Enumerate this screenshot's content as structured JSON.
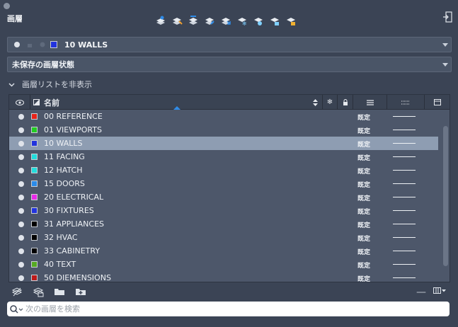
{
  "panel": {
    "title": "画層"
  },
  "current_layer": {
    "name": "10 WALLS",
    "color": "#2233dd"
  },
  "layer_state": {
    "value": "未保存の画層状態"
  },
  "hide_list": {
    "label": "画層リストを非表示"
  },
  "table": {
    "headers": {
      "name": "名前"
    },
    "rows": [
      {
        "name": "00 REFERENCE",
        "color": "#e8231a",
        "linetype": "既定",
        "selected": false
      },
      {
        "name": "01 VIEWPORTS",
        "color": "#22cc22",
        "linetype": "既定",
        "selected": false
      },
      {
        "name": "10 WALLS",
        "color": "#2233dd",
        "linetype": "既定",
        "selected": true
      },
      {
        "name": "11 FACING",
        "color": "#22dddd",
        "linetype": "既定",
        "selected": false
      },
      {
        "name": "12 HATCH",
        "color": "#22dddd",
        "linetype": "既定",
        "selected": false
      },
      {
        "name": "15 DOORS",
        "color": "#2a8ae8",
        "linetype": "既定",
        "selected": false
      },
      {
        "name": "20 ELECTRICAL",
        "color": "#e82ae8",
        "linetype": "既定",
        "selected": false
      },
      {
        "name": "30 FIXTURES",
        "color": "#2233dd",
        "linetype": "既定",
        "selected": false
      },
      {
        "name": "31 APPLIANCES",
        "color": "#000000",
        "linetype": "既定",
        "selected": false
      },
      {
        "name": "32 HVAC",
        "color": "#000000",
        "linetype": "既定",
        "selected": false
      },
      {
        "name": "33 CABINETRY",
        "color": "#000000",
        "linetype": "既定",
        "selected": false
      },
      {
        "name": "40 TEXT",
        "color": "#55aa22",
        "linetype": "既定",
        "selected": false
      },
      {
        "name": "50 DIEMENSIONS",
        "color": "#bb1a1a",
        "linetype": "既定",
        "selected": false
      }
    ]
  },
  "search": {
    "placeholder": "次の画層を検索"
  },
  "colors": {
    "panel_bg": "#3b4455",
    "row_bg": "#4d576a",
    "selected_row": "#8e9db2",
    "accent": "#2f8ce8"
  }
}
